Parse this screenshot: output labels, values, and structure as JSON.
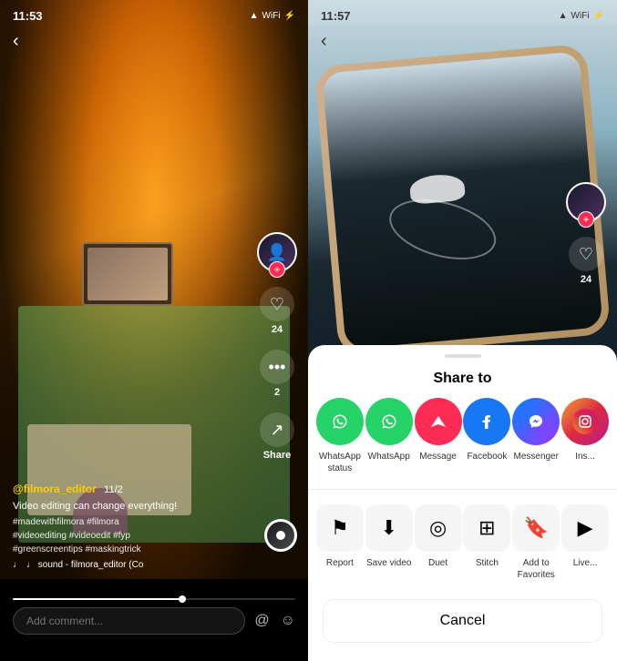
{
  "left": {
    "status_time": "11:53",
    "status_icons": [
      "▲",
      "WiFi",
      "⚡"
    ],
    "back": "‹",
    "username": "@filmora_editor",
    "username_num": "11/2",
    "caption": "Video editing can change everything!",
    "hashtags": "#madewithfilmora #filmora\n#videoediting #videoedit #fyp\n#greenscreentips #maskingtrick",
    "sound_label": "♩ sound - filmora_editor (Co",
    "like_count": "24",
    "comment_count": "2",
    "share_label": "Share",
    "comment_placeholder": "Add comment...",
    "avatar_plus": "+"
  },
  "right": {
    "status_time": "11:57",
    "back": "‹",
    "like_count": "24",
    "avatar_plus": "+",
    "share_title": "Share to",
    "share_icons": [
      {
        "label": "WhatsApp status",
        "bg": "#25D366",
        "icon": "W"
      },
      {
        "label": "WhatsApp",
        "bg": "#25D366",
        "icon": "W"
      },
      {
        "label": "Message",
        "bg": "#fe2c55",
        "icon": "▲"
      },
      {
        "label": "Facebook",
        "bg": "#1877F2",
        "icon": "f"
      },
      {
        "label": "Messenger",
        "bg": "#0084FF",
        "icon": "M"
      },
      {
        "label": "Ins...",
        "bg": "#E1306C",
        "icon": "📷"
      }
    ],
    "share_actions": [
      {
        "label": "Report",
        "icon": "⚑"
      },
      {
        "label": "Save video",
        "icon": "⬇"
      },
      {
        "label": "Duet",
        "icon": "◎"
      },
      {
        "label": "Stitch",
        "icon": "⊞"
      },
      {
        "label": "Add to Favorites",
        "icon": "🔖"
      },
      {
        "label": "Live...",
        "icon": "▶"
      }
    ],
    "cancel_label": "Cancel"
  }
}
